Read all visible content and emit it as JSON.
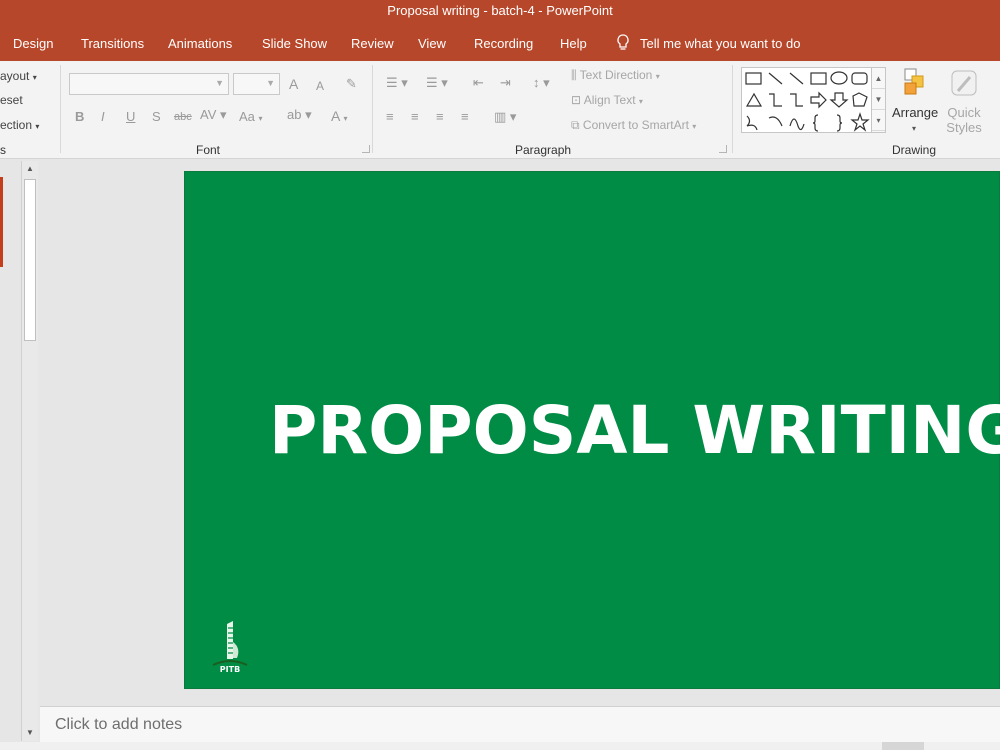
{
  "window": {
    "title": "Proposal writing - batch-4  -  PowerPoint"
  },
  "tabs": [
    "Design",
    "Transitions",
    "Animations",
    "Slide Show",
    "Review",
    "View",
    "Recording",
    "Help"
  ],
  "tell_me": "Tell me what you want to do",
  "ribbon": {
    "slides_group": {
      "layout": "ayout",
      "reset": "eset",
      "section": "ection",
      "label": "s"
    },
    "font_group": {
      "label": "Font",
      "grow": "A",
      "shrink": "A",
      "case": "Aa",
      "color": "A",
      "bold": "B",
      "italic": "I",
      "underline": "U",
      "shadow": "S",
      "strike": "abc"
    },
    "paragraph_group": {
      "label": "Paragraph",
      "text_direction": "Text Direction",
      "align_text": "Align Text",
      "smartart": "Convert to SmartArt"
    },
    "drawing_group": {
      "label": "Drawing",
      "arrange": "Arrange",
      "quick": "Quick",
      "styles": "Styles"
    }
  },
  "slide": {
    "title": "PROPOSAL WRITING",
    "logo_text": "PITB",
    "background": "#008c45"
  },
  "notes": {
    "placeholder": "Click to add notes"
  },
  "colors": {
    "accent": "#b7472a",
    "slide_bg": "#008c45"
  }
}
